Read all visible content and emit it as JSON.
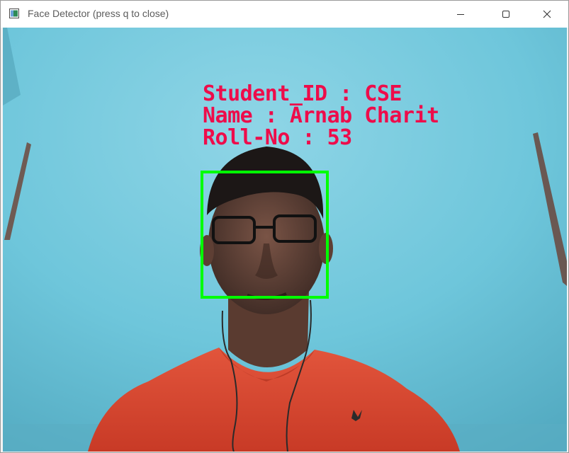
{
  "window": {
    "title": "Face Detector (press q to close)",
    "controls": {
      "minimize": "minimize-icon",
      "maximize": "maximize-icon",
      "close": "close-icon"
    }
  },
  "overlay": {
    "student_id": "Student_ID : CSE",
    "name": "Name : Arnab Charit",
    "roll_no": "Roll-No : 53",
    "text_color": "#ee0c4a"
  },
  "detection": {
    "box_color": "#00ff00",
    "box_label": "face-detection-box"
  }
}
